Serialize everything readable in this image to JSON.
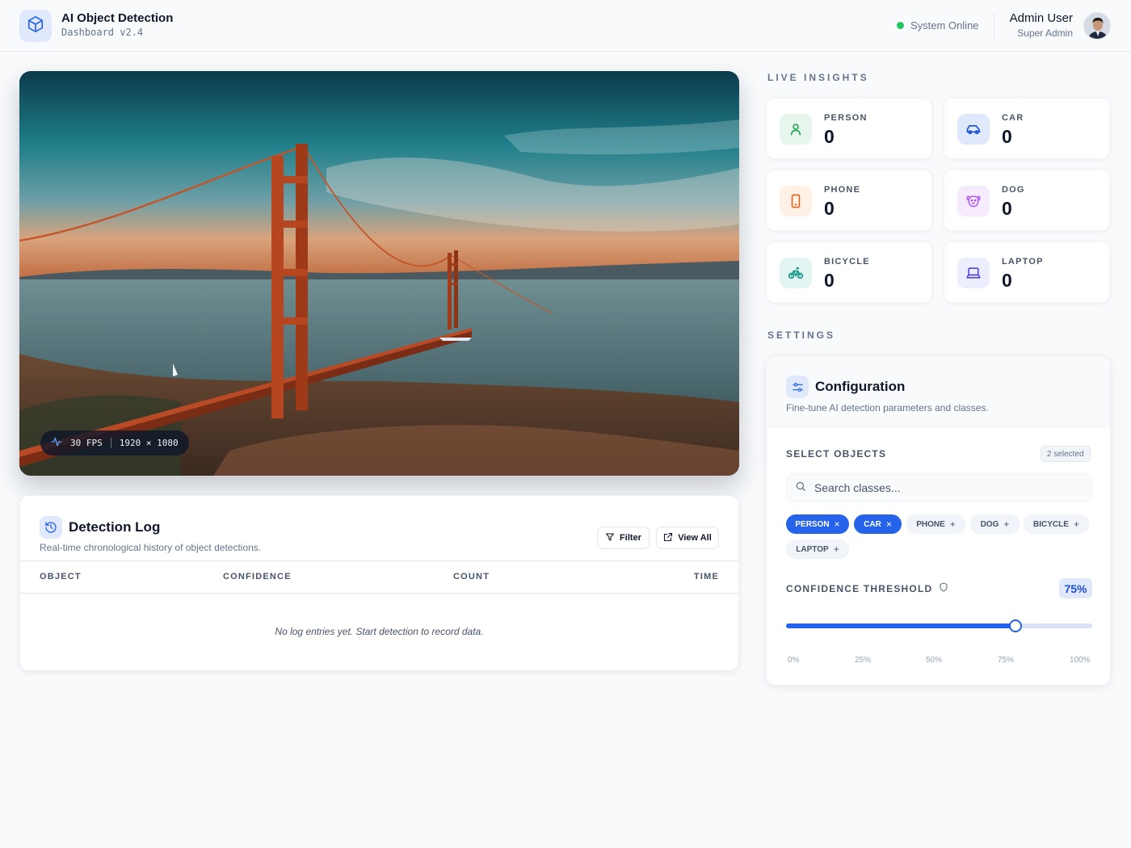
{
  "header": {
    "app_title": "AI Object Detection",
    "app_subtitle": "Dashboard v2.4",
    "status_text": "System Online",
    "status_color": "#22c55e",
    "user_name": "Admin User",
    "user_role": "Super Admin",
    "logo_icon": "cube-icon"
  },
  "video": {
    "fps": "30 FPS",
    "resolution": "1920 × 1080"
  },
  "log": {
    "title": "Detection Log",
    "subtitle": "Real-time chronological history of object detections.",
    "filter_label": "Filter",
    "view_all_label": "View All",
    "columns": [
      "OBJECT",
      "CONFIDENCE",
      "COUNT",
      "TIME"
    ],
    "empty_text": "No log entries yet. Start detection to record data."
  },
  "insights": {
    "title": "LIVE INSIGHTS",
    "stats": [
      {
        "label": "PERSON",
        "value": "0",
        "icon": "person-icon",
        "color": "#16a34a"
      },
      {
        "label": "CAR",
        "value": "0",
        "icon": "car-icon",
        "color": "#1d4ed8"
      },
      {
        "label": "PHONE",
        "value": "0",
        "icon": "phone-icon",
        "color": "#ea580c"
      },
      {
        "label": "DOG",
        "value": "0",
        "icon": "dog-icon",
        "color": "#a855f7"
      },
      {
        "label": "BICYCLE",
        "value": "0",
        "icon": "bicycle-icon",
        "color": "#0d9488"
      },
      {
        "label": "LAPTOP",
        "value": "0",
        "icon": "laptop-icon",
        "color": "#4f46e5"
      }
    ]
  },
  "settings": {
    "title": "SETTINGS",
    "config_title": "Configuration",
    "config_subtitle": "Fine-tune AI detection parameters and classes.",
    "select_label": "SELECT OBJECTS",
    "selected_count": "2 selected",
    "search_placeholder": "Search classes...",
    "chips": [
      {
        "label": "PERSON",
        "selected": true,
        "action": "×"
      },
      {
        "label": "CAR",
        "selected": true,
        "action": "×"
      },
      {
        "label": "PHONE",
        "selected": false,
        "action": "+"
      },
      {
        "label": "DOG",
        "selected": false,
        "action": "+"
      },
      {
        "label": "BICYCLE",
        "selected": false,
        "action": "+"
      },
      {
        "label": "LAPTOP",
        "selected": false,
        "action": "+"
      }
    ],
    "threshold_label": "CONFIDENCE THRESHOLD",
    "threshold_value": "75%",
    "threshold_fraction": 0.75,
    "ticks": [
      "0%",
      "25%",
      "50%",
      "75%",
      "100%"
    ],
    "accent_color": "#2563eb"
  }
}
